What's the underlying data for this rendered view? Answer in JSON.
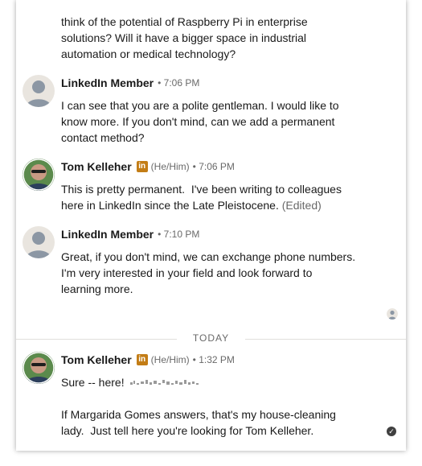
{
  "messages": [
    {
      "text": "think of the potential of Raspberry Pi in enterprise\nsolutions? Will it have a bigger space in industrial\nautomation or medical technology?"
    },
    {
      "sender": "LinkedIn Member",
      "time": "• 7:06 PM",
      "text": "I can see that you are a polite gentleman. I would like to\nknow more. If you don't mind, can we add a permanent\ncontact method?"
    },
    {
      "sender": "Tom Kelleher",
      "badge": "in",
      "pronouns": "(He/Him)",
      "time": "• 7:06 PM",
      "text": "This is pretty permanent.  I've been writing to colleagues\nhere in LinkedIn since the Late Pleistocene. ",
      "edited": "(Edited)"
    },
    {
      "sender": "LinkedIn Member",
      "time": "• 7:10 PM",
      "text": "Great, if you don't mind, we can exchange phone numbers.\nI'm very interested in your field and look forward to\nlearning more."
    },
    {
      "sender": "Tom Kelleher",
      "badge": "in",
      "pronouns": "(He/Him)",
      "time": "• 1:32 PM",
      "text": "Sure -- here! ",
      "text2": "If Margarida Gomes answers, that's my house-cleaning\nlady.  Just tell here you're looking for Tom Kelleher."
    }
  ],
  "divider": "TODAY",
  "colors": {
    "badge": "#c37d16",
    "ghost_avatar_bg": "#e9e5df",
    "ghost_avatar_fg": "#8c97a4"
  },
  "icons": {
    "ghost_avatar": "person-silhouette-icon",
    "photo_avatar": "profile-photo-icon",
    "read_receipt": "read-receipt-avatar-icon",
    "sent": "check-circle-icon"
  }
}
